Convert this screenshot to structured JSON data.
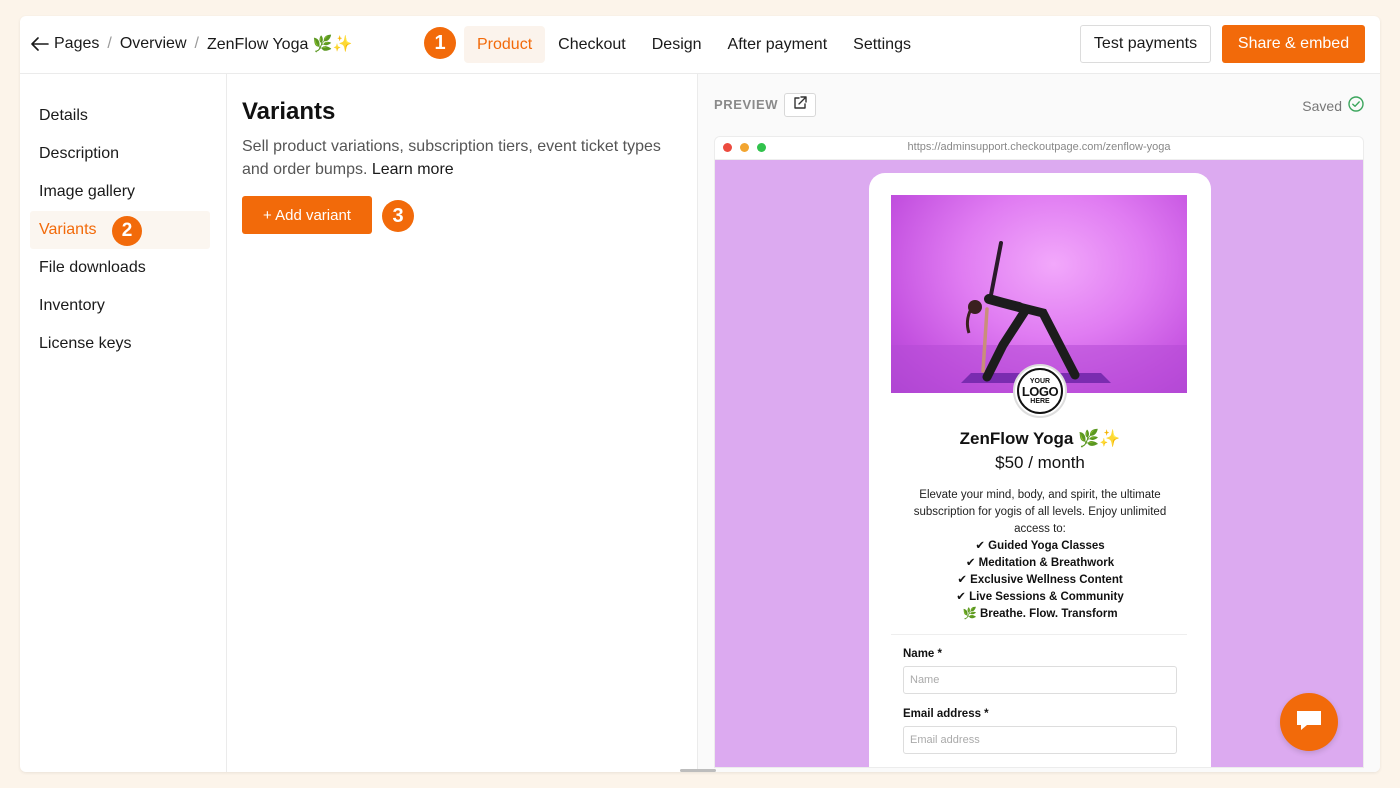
{
  "breadcrumbs": [
    {
      "label": "Pages"
    },
    {
      "label": "Overview"
    },
    {
      "label": "ZenFlow Yoga 🌿✨"
    }
  ],
  "breadcrumb_separator": "/",
  "step_badges": [
    "1",
    "2",
    "3"
  ],
  "nav_tabs": [
    {
      "label": "Product",
      "active": true
    },
    {
      "label": "Checkout"
    },
    {
      "label": "Design"
    },
    {
      "label": "After payment"
    },
    {
      "label": "Settings"
    }
  ],
  "header_actions": {
    "test_payments": "Test payments",
    "share_embed": "Share & embed"
  },
  "sidebar": {
    "items": [
      {
        "label": "Details"
      },
      {
        "label": "Description"
      },
      {
        "label": "Image gallery"
      },
      {
        "label": "Variants",
        "active": true
      },
      {
        "label": "File downloads"
      },
      {
        "label": "Inventory"
      },
      {
        "label": "License keys"
      }
    ]
  },
  "main": {
    "title": "Variants",
    "description": "Sell product variations, subscription tiers, event ticket types and order bumps.",
    "learn_more": "Learn more",
    "add_button": "+ Add variant"
  },
  "preview": {
    "label": "PREVIEW",
    "saved": "Saved",
    "url": "https://adminsupport.checkoutpage.com/zenflow-yoga",
    "logo_top": "YOUR",
    "logo_mid": "LOGO",
    "logo_bot": "HERE",
    "product_title": "ZenFlow Yoga 🌿✨",
    "price": "$50 / month",
    "description": "Elevate your mind, body, and spirit, the ultimate subscription for yogis of all levels. Enjoy unlimited access to:",
    "features": [
      "✔ Guided Yoga Classes",
      "✔ Meditation & Breathwork",
      "✔ Exclusive Wellness Content",
      "✔ Live Sessions & Community",
      "🌿 Breathe. Flow. Transform"
    ],
    "form": {
      "name_label": "Name *",
      "name_placeholder": "Name",
      "email_label": "Email address *",
      "email_placeholder": "Email address"
    }
  },
  "colors": {
    "accent": "#f26a0a",
    "preview_background": "#dcaaf0",
    "page_background": "#fcf4ea"
  },
  "icons": {
    "back": "arrow-left-icon",
    "external": "external-link-icon",
    "saved": "check-circle-icon",
    "chat": "chat-bubble-icon"
  }
}
